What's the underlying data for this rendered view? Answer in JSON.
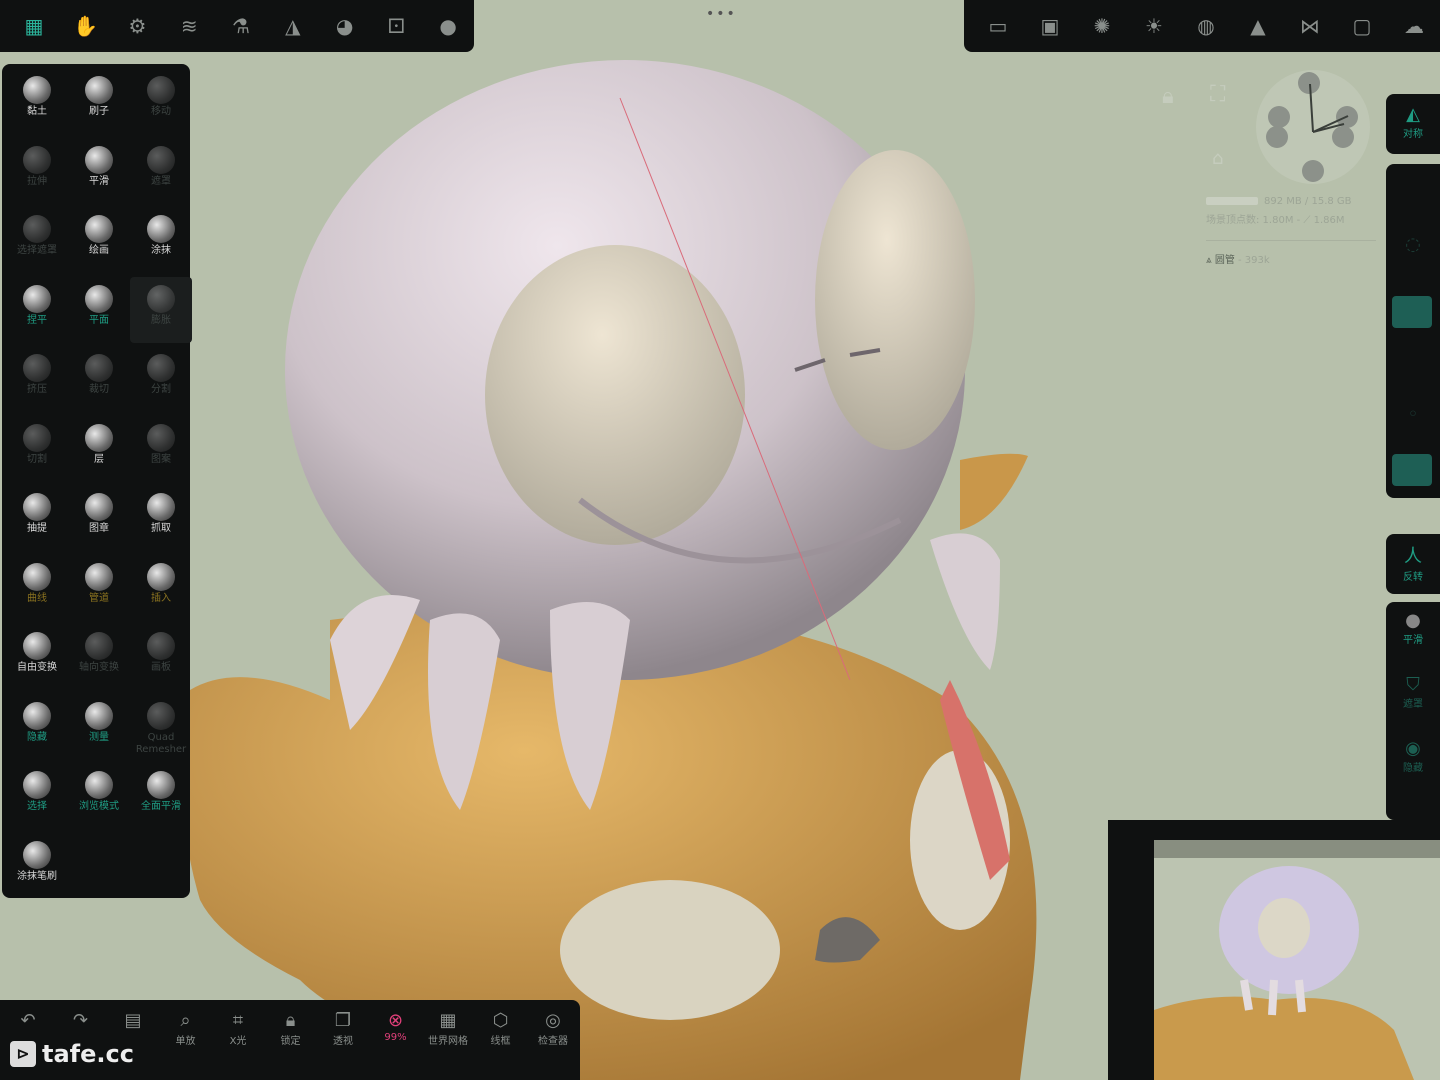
{
  "top_left_toolbar": {
    "icons": [
      "brush-tool-icon",
      "hand-icon",
      "gear-icon",
      "layers-icon",
      "flask-icon",
      "symmetry-icon",
      "palette-icon",
      "dice-icon",
      "material-sphere-icon"
    ]
  },
  "top_right_toolbar": {
    "icons": [
      "camera-icon",
      "image-icon",
      "aperture-icon",
      "sun-icon",
      "globe-icon",
      "pyramid-icon",
      "share-icon",
      "folder-icon",
      "cloud-icon"
    ]
  },
  "tools": [
    {
      "label": "黏土",
      "state": "normal"
    },
    {
      "label": "刷子",
      "state": "normal"
    },
    {
      "label": "移动",
      "state": "dim"
    },
    {
      "label": "拉伸",
      "state": "dim"
    },
    {
      "label": "平滑",
      "state": "normal"
    },
    {
      "label": "遮罩",
      "state": "dim"
    },
    {
      "label": "选择遮罩",
      "state": "dim"
    },
    {
      "label": "绘画",
      "state": "normal"
    },
    {
      "label": "涂抹",
      "state": "normal"
    },
    {
      "label": "捏平",
      "state": "green"
    },
    {
      "label": "平面",
      "state": "green"
    },
    {
      "label": "膨胀",
      "state": "dim"
    },
    {
      "label": "挤压",
      "state": "dim"
    },
    {
      "label": "裁切",
      "state": "dim"
    },
    {
      "label": "分割",
      "state": "dim"
    },
    {
      "label": "切割",
      "state": "dim"
    },
    {
      "label": "层",
      "state": "normal"
    },
    {
      "label": "图案",
      "state": "dim"
    },
    {
      "label": "抽提",
      "state": "normal"
    },
    {
      "label": "图章",
      "state": "normal"
    },
    {
      "label": "抓取",
      "state": "normal"
    },
    {
      "label": "曲线",
      "state": "yellow"
    },
    {
      "label": "管道",
      "state": "yellow"
    },
    {
      "label": "插入",
      "state": "yellow"
    },
    {
      "label": "自由变换",
      "state": "normal"
    },
    {
      "label": "轴向变换",
      "state": "dim"
    },
    {
      "label": "画板",
      "state": "dim"
    },
    {
      "label": "隐藏",
      "state": "green"
    },
    {
      "label": "测量",
      "state": "green"
    },
    {
      "label": "Quad Remesher",
      "state": "dim"
    },
    {
      "label": "选择",
      "state": "green"
    },
    {
      "label": "浏览模式",
      "state": "green"
    },
    {
      "label": "全面平滑",
      "state": "green"
    },
    {
      "label": "涂抹笔刷",
      "state": "normal"
    }
  ],
  "bottom_bar": [
    {
      "label": "",
      "icon": "undo-icon"
    },
    {
      "label": "",
      "icon": "redo-icon"
    },
    {
      "label": "",
      "icon": "notes-icon"
    },
    {
      "label": "单放",
      "icon": "zoom-icon"
    },
    {
      "label": "X光",
      "icon": "xray-icon"
    },
    {
      "label": "锁定",
      "icon": "lock-icon"
    },
    {
      "label": "透视",
      "icon": "perspective-icon"
    },
    {
      "label": "99%",
      "icon": "close-circle-icon"
    },
    {
      "label": "世界网格",
      "icon": "grid-icon"
    },
    {
      "label": "线框",
      "icon": "wireframe-icon"
    },
    {
      "label": "检查器",
      "icon": "inspector-icon"
    }
  ],
  "logo": "tafe.cc",
  "right_strip_top": {
    "label": "对称"
  },
  "right_strip_mid": {
    "label": "反转"
  },
  "right_strip_bottom": [
    {
      "label": "平滑"
    },
    {
      "label": "遮罩"
    },
    {
      "label": "隐藏"
    }
  ],
  "stats": {
    "memory": "892 MB / 15.8 GB",
    "vertices": "场景顶点数: 1.80M - ⟋ 1.86M",
    "mesh_name": "圆管",
    "mesh_count": " - 393k"
  },
  "colors": {
    "accent": "#1f9c83",
    "viewport_bg": "#b7c0ab",
    "panel": "#0f1111"
  }
}
